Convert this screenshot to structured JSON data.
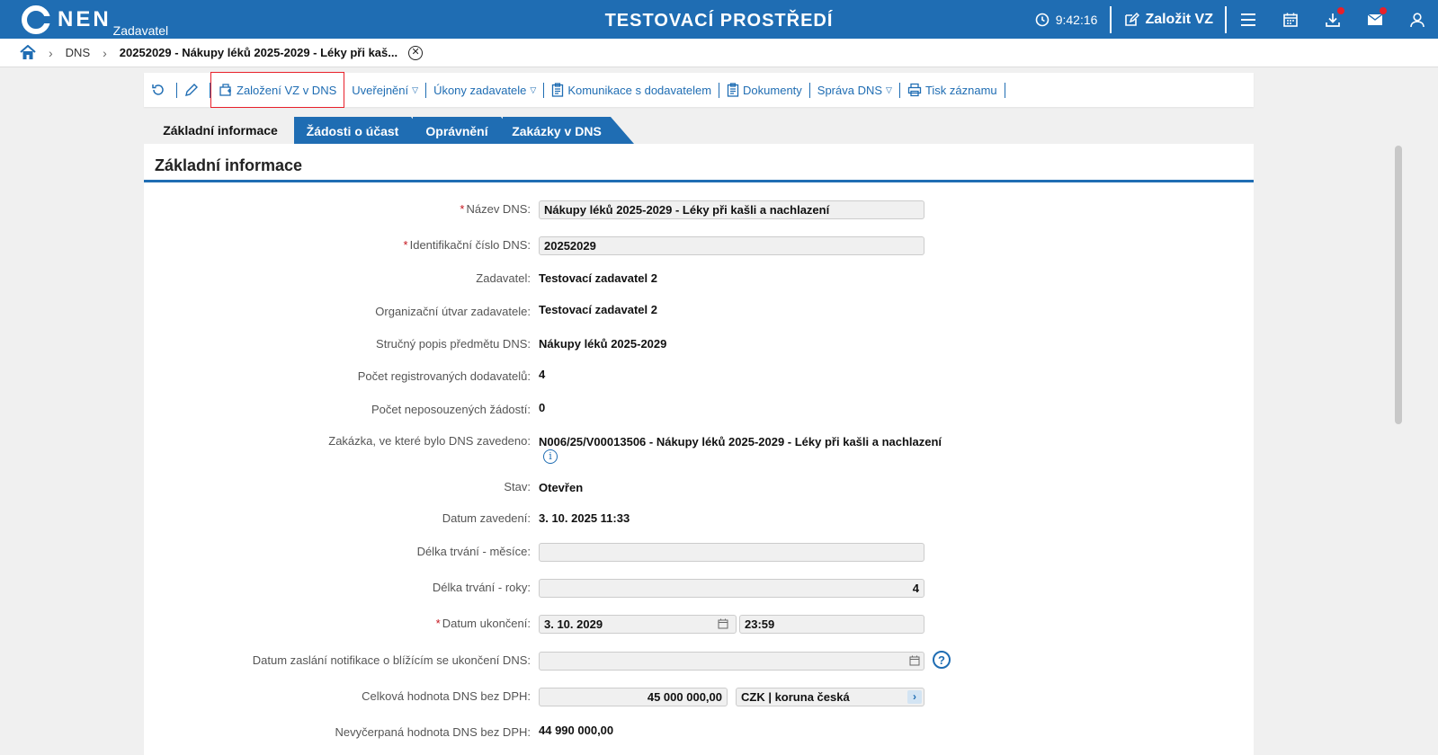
{
  "header": {
    "logo_text": "NEN",
    "logo_sub": "Zadavatel",
    "env_title": "TESTOVACÍ PROSTŘEDÍ",
    "time": "9:42:16",
    "create_vz": "Založit VZ",
    "icons": [
      "clock-icon",
      "edit-icon",
      "menu-icon",
      "calendar-icon",
      "download-icon",
      "mail-icon",
      "user-icon"
    ],
    "accent_color": "#1f6db3",
    "notification_color": "#e8202a"
  },
  "breadcrumb": {
    "items": [
      "DNS"
    ],
    "current": "20252029 - Nákupy léků 2025-2029 - Léky při kaš..."
  },
  "toolbar": {
    "create_vz_dns": "Založení VZ v DNS",
    "publish": "Uveřejnění",
    "acts": "Úkony zadavatele",
    "communication": "Komunikace s dodavatelem",
    "documents": "Dokumenty",
    "manage": "Správa DNS",
    "print": "Tisk záznamu"
  },
  "tabs": [
    "Základní informace",
    "Žádosti o účast",
    "Oprávnění",
    "Zakázky v DNS"
  ],
  "section_title": "Základní informace",
  "fields": {
    "name_label": "Název DNS:",
    "name_value": "Nákupy léků 2025-2029 - Léky při kašli a nachlazení",
    "id_label": "Identifikační číslo DNS:",
    "id_value": "20252029",
    "contracting_label": "Zadavatel:",
    "contracting_value": "Testovací zadavatel 2",
    "org_unit_label": "Organizační útvar zadavatele:",
    "org_unit_value": "Testovací zadavatel 2",
    "description_label": "Stručný popis předmětu DNS:",
    "description_value": "Nákupy léků 2025-2029",
    "registered_label": "Počet registrovaných dodavatelů:",
    "registered_value": "4",
    "unassessed_label": "Počet neposouzených žádostí:",
    "unassessed_value": "0",
    "origin_label": "Zakázka, ve které bylo DNS zavedeno:",
    "origin_value": "N006/25/V00013506 - Nákupy léků 2025-2029 - Léky při kašli a nachlazení",
    "status_label": "Stav:",
    "status_value": "Otevřen",
    "date_label": "Datum zavedení:",
    "date_value": "3. 10. 2025 11:33",
    "months_label": "Délka trvání - měsíce:",
    "months_value": "",
    "years_label": "Délka trvání - roky:",
    "years_value": "4",
    "end_label": "Datum ukončení:",
    "end_date": "3. 10. 2029",
    "end_time": "23:59",
    "notif_label": "Datum zaslání notifikace o blížícím se ukončení DNS:",
    "notif_value": "",
    "total_label": "Celková hodnota DNS bez DPH:",
    "total_value": "45 000 000,00",
    "currency": "CZK | koruna česká",
    "remaining_label": "Nevyčerpaná hodnota DNS bez DPH:",
    "remaining_value": "44 990 000,00"
  }
}
